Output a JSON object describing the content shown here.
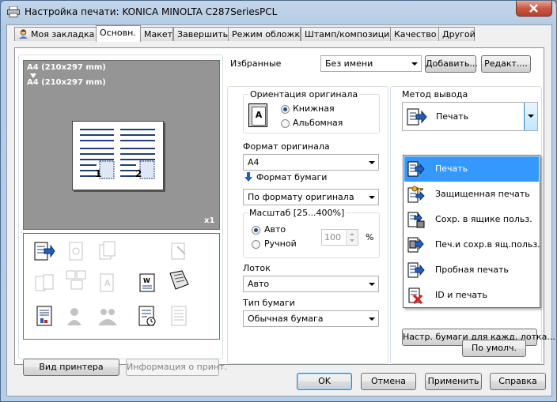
{
  "window": {
    "title": "Настройка печати: KONICA MINOLTA C287SeriesPCL"
  },
  "tabs": [
    {
      "label": "Моя закладка",
      "has_icon": true
    },
    {
      "label": "Основн.",
      "active": true
    },
    {
      "label": "Макет"
    },
    {
      "label": "Завершить"
    },
    {
      "label": "Режим обложки"
    },
    {
      "label": "Штамп/композиция"
    },
    {
      "label": "Качество"
    },
    {
      "label": "Другой"
    }
  ],
  "preview": {
    "line1": "A4 (210x297 mm)",
    "line2": "A4 (210x297 mm)",
    "copies": "x1",
    "page_numbers": [
      "1",
      "2"
    ]
  },
  "icon_panel": {
    "icons": [
      "output-method-print-icon",
      "collate-icon",
      "copies-icon",
      "",
      "staple-disabled-icon",
      "duplex-icon",
      "booklet-icon",
      "punch-icon",
      "fold-icon",
      "slip-sheet-icon",
      "color-document-icon",
      "secure-user-icon",
      "account-icon",
      "stamp-icon",
      "watermark-icon"
    ]
  },
  "buttons": {
    "printer_view": "Вид принтера",
    "printer_info": "Информация о принт.",
    "defaults": "По умолч.",
    "tray_paper": "Настр. бумаги для кажд. лотка...",
    "add": "Добавить...",
    "edit": "Редакт....",
    "ok": "OK",
    "cancel": "Отмена",
    "apply": "Применить",
    "help": "Справка"
  },
  "favorites": {
    "label": "Избранные",
    "value": "Без имени"
  },
  "orientation": {
    "label": "Ориентация оригинала",
    "options": [
      "Книжная",
      "Альбомная"
    ],
    "selected": "Книжная"
  },
  "original_size": {
    "label": "Формат оригинала",
    "value": "A4"
  },
  "paper_size": {
    "label": "Формат бумаги",
    "value": "По формату оригинала"
  },
  "zoom": {
    "label": "Масштаб [25...400%]",
    "options": [
      "Авто",
      "Ручной"
    ],
    "selected": "Авто",
    "value": "100",
    "unit": "%"
  },
  "tray": {
    "label": "Лоток",
    "value": "Авто"
  },
  "paper_type": {
    "label": "Тип бумаги",
    "value": "Обычная бумага"
  },
  "output_method": {
    "label": "Метод вывода",
    "value": "Печать",
    "options": [
      {
        "label": "Печать",
        "selected": true
      },
      {
        "label": "Защищенная печать"
      },
      {
        "label": "Сохр. в ящике польз."
      },
      {
        "label": "Печ.и сохр.в ящ.польз."
      },
      {
        "label": "Пробная печать"
      },
      {
        "label": "ID и печать"
      }
    ]
  },
  "colors": {
    "accent": "#3399ff",
    "title_bg": "#b9cde5",
    "close": "#c75a45"
  }
}
